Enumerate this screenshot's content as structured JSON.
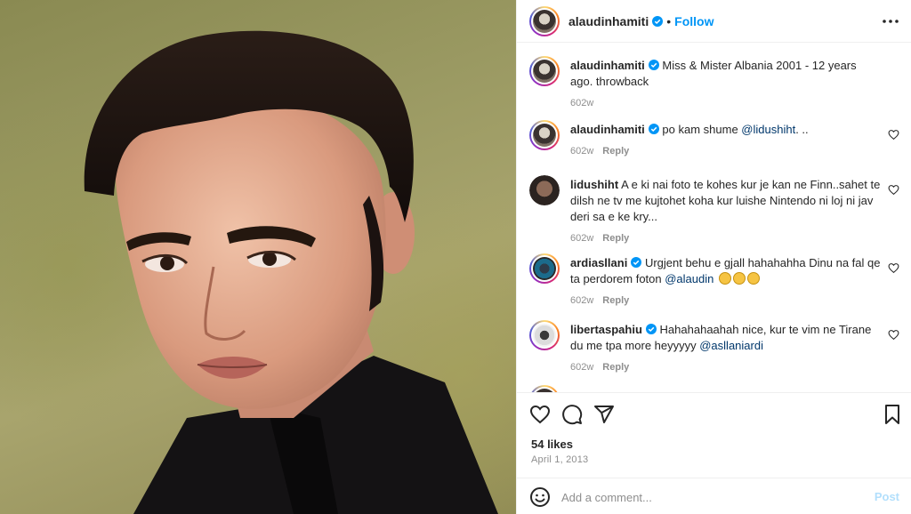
{
  "post": {
    "author": "alaudinhamiti",
    "follow_label": "Follow",
    "separator": "•"
  },
  "caption": {
    "user": "alaudinhamiti",
    "text": "Miss & Mister Albania 2001 - 12 years ago. throwback",
    "time": "602w"
  },
  "comments": [
    {
      "user": "alaudinhamiti",
      "text": "po kam shume ",
      "mention": "@lidushiht",
      "after": ". ..",
      "time": "602w",
      "reply": "Reply"
    },
    {
      "user": "lidushiht",
      "text": "A e ki nai foto te kohes kur je kan ne Finn..sahet te dilsh ne tv me kujtohet koha kur luishe Nintendo ni loj ni jav deri sa e ke kry...",
      "time": "602w",
      "reply": "Reply"
    },
    {
      "user": "ardiasllani",
      "text": "Urgjent behu e gjall hahahahha Dinu na fal qe ta perdorem foton ",
      "mention": "@alaudin",
      "time": "602w",
      "reply": "Reply"
    },
    {
      "user": "libertaspahiu",
      "text": "Hahahahaahah nice, kur te vim ne Tirane du me tpa more heyyyyy ",
      "mention": "@asllaniardi",
      "time": "602w",
      "reply": "Reply"
    }
  ],
  "stats": {
    "likes": "54 likes",
    "date": "April 1, 2013"
  },
  "composer": {
    "placeholder": "Add a comment...",
    "post_label": "Post"
  },
  "icons": {
    "more": "more-icon",
    "verified": "verified-icon",
    "heart": "heart-icon",
    "like": "like-icon",
    "comment": "comment-icon",
    "share": "share-icon",
    "save": "bookmark-icon",
    "emoji": "emoji-icon"
  },
  "colors": {
    "accent": "#0095f6",
    "verified": "#0095f6",
    "mention": "#00376b",
    "muted": "#8e8e8e",
    "post_disabled": "#b2dffc"
  }
}
